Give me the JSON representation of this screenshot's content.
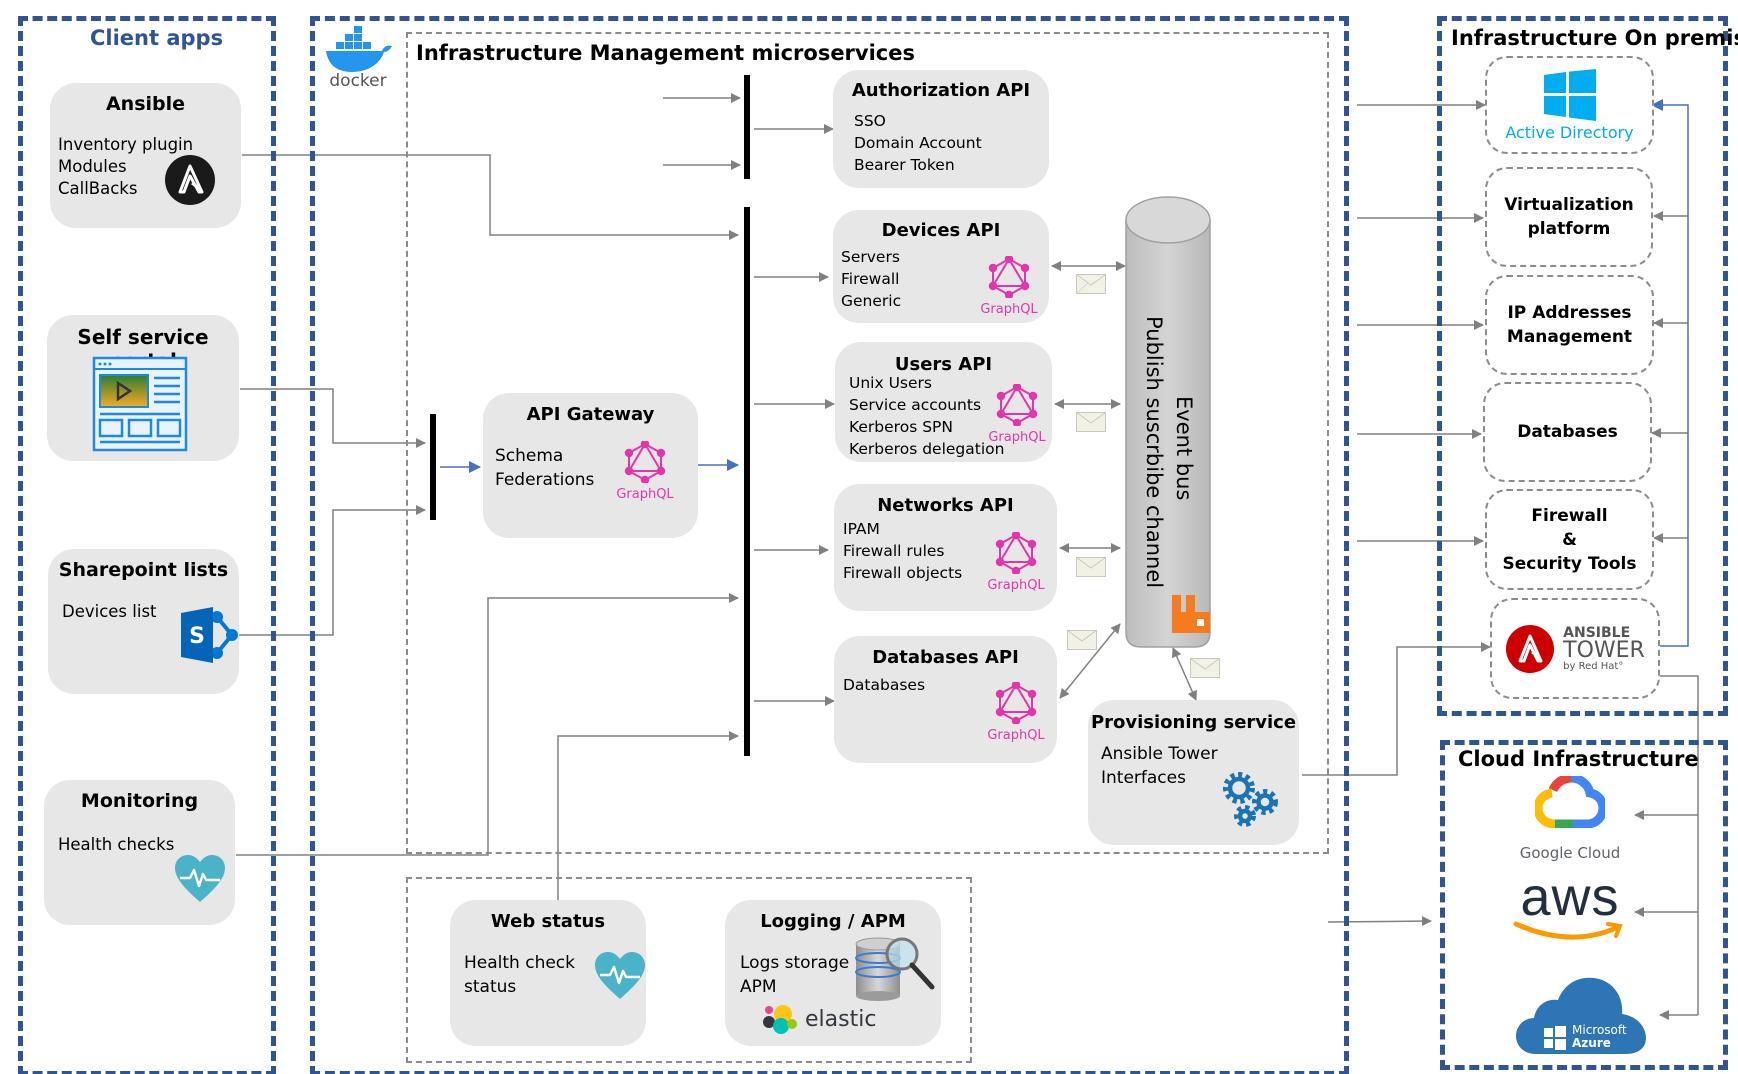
{
  "client_apps": {
    "title": "Client apps",
    "ansible": {
      "title": "Ansible",
      "lines": [
        "Inventory plugin",
        "Modules",
        "CallBacks"
      ],
      "icon": "ansible-logo-icon"
    },
    "self_service_portal": {
      "title": "Self service portal",
      "icon": "web-portal-icon"
    },
    "sharepoint": {
      "title": "Sharepoint lists",
      "lines": [
        "Devices list"
      ],
      "icon": "sharepoint-icon"
    },
    "monitoring": {
      "title": "Monitoring",
      "lines": [
        "Health checks"
      ],
      "icon": "heart-pulse-icon"
    }
  },
  "microservices": {
    "platform_logo": "docker",
    "title": "Infrastructure Management microservices",
    "api_gateway": {
      "title": "API Gateway",
      "lines": [
        "Schema",
        "Federations"
      ],
      "badge": "GraphQL"
    },
    "authorization_api": {
      "title": "Authorization API",
      "lines": [
        "SSO",
        "Domain Account",
        "Bearer Token"
      ]
    },
    "devices_api": {
      "title": "Devices API",
      "lines": [
        "Servers",
        "Firewall",
        "Generic"
      ],
      "badge": "GraphQL"
    },
    "users_api": {
      "title": "Users API",
      "lines": [
        "Unix Users",
        "Service accounts",
        "Kerberos SPN",
        "Kerberos delegation"
      ],
      "badge": "GraphQL"
    },
    "networks_api": {
      "title": "Networks API",
      "lines": [
        "IPAM",
        "Firewall rules",
        "Firewall objects"
      ],
      "badge": "GraphQL"
    },
    "databases_api": {
      "title": "Databases API",
      "lines": [
        "Databases"
      ],
      "badge": "GraphQL"
    },
    "event_bus": {
      "line1": "Event bus",
      "line2": "Publish suscrbibe channel",
      "icon": "rabbitmq-icon"
    },
    "provisioning": {
      "title": "Provisioning service",
      "lines": [
        "Ansible Tower",
        "Interfaces"
      ],
      "icon": "gears-icon"
    }
  },
  "observability": {
    "web_status": {
      "title": "Web status",
      "lines": [
        "Health check",
        "status"
      ],
      "icon": "heart-pulse-icon"
    },
    "logging": {
      "title": "Logging / APM",
      "lines": [
        "Logs storage",
        "APM"
      ],
      "brand": "elastic",
      "icon": "database-search-icon"
    }
  },
  "on_premise": {
    "title": "Infrastructure On premise",
    "items": [
      {
        "label": "Active Directory",
        "icon": "windows-icon"
      },
      {
        "label": "Virtualization\nplatform"
      },
      {
        "label": "IP Addresses\nManagement"
      },
      {
        "label": "Databases"
      },
      {
        "label": "Firewall\n&\nSecurity Tools"
      },
      {
        "label": "ANSIBLE",
        "sub1": "TOWER",
        "sub2": "by Red Hat°",
        "icon": "ansible-tower-icon"
      }
    ]
  },
  "cloud": {
    "title": "Cloud Infrastructure",
    "providers": [
      {
        "label": "Google Cloud",
        "icon": "google-cloud-icon"
      },
      {
        "label": "aws",
        "icon": "aws-icon"
      },
      {
        "label_line1": "Microsoft",
        "label_line2": "Azure",
        "icon": "azure-icon"
      }
    ]
  },
  "colors": {
    "group_border": "#2f5597",
    "client_title": "#2f5597",
    "card_bg": "#e7e7e7",
    "graphql": "#e535ab",
    "connector": "#808080",
    "gateway_arrow": "#4472c4",
    "windows_blue": "#00adef",
    "rabbitmq_orange": "#f47b20",
    "ansible_red": "#cc0000",
    "heart": "#4ab3c8"
  }
}
